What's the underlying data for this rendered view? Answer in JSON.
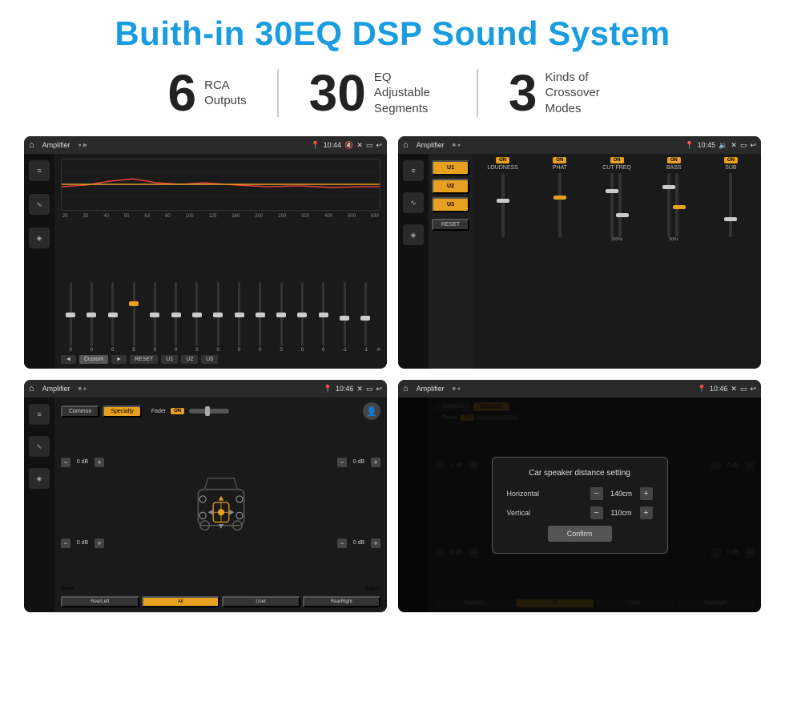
{
  "page": {
    "main_title": "Buith-in 30EQ DSP Sound System",
    "stats": [
      {
        "number": "6",
        "label": "RCA\nOutputs"
      },
      {
        "number": "30",
        "label": "EQ Adjustable\nSegments"
      },
      {
        "number": "3",
        "label": "Kinds of\nCrossover Modes"
      }
    ],
    "screens": [
      {
        "id": "screen1",
        "status_bar": {
          "app_name": "Amplifier",
          "time": "10:44"
        },
        "eq_frequencies": [
          "25",
          "32",
          "40",
          "50",
          "63",
          "80",
          "100",
          "125",
          "160",
          "200",
          "250",
          "320",
          "400",
          "500",
          "630"
        ],
        "eq_values": [
          "0",
          "0",
          "0",
          "5",
          "0",
          "0",
          "0",
          "0",
          "0",
          "0",
          "0",
          "0",
          "0",
          "-1",
          "0",
          "-1"
        ],
        "preset_label": "Custom",
        "buttons": [
          "◄",
          "Custom",
          "►",
          "RESET",
          "U1",
          "U2",
          "U3"
        ]
      },
      {
        "id": "screen2",
        "status_bar": {
          "app_name": "Amplifier",
          "time": "10:45"
        },
        "presets": [
          "U1",
          "U2",
          "U3"
        ],
        "sections": [
          "LOUDNESS",
          "PHAT",
          "CUT FREQ",
          "BASS",
          "SUB"
        ],
        "on_labels": [
          "ON",
          "ON",
          "ON",
          "ON",
          "ON"
        ],
        "reset_label": "RESET"
      },
      {
        "id": "screen3",
        "status_bar": {
          "app_name": "Amplifier",
          "time": "10:46"
        },
        "tabs": [
          "Common",
          "Specialty"
        ],
        "active_tab": "Specialty",
        "fader_label": "Fader",
        "fader_on": "ON",
        "volume_controls": [
          {
            "label": "0 dB"
          },
          {
            "label": "0 dB"
          },
          {
            "label": "0 dB"
          },
          {
            "label": "0 dB"
          }
        ],
        "bottom_buttons": [
          "Driver",
          "",
          "Copilot",
          "RearLeft",
          "All",
          "User",
          "RearRight"
        ]
      },
      {
        "id": "screen4",
        "status_bar": {
          "app_name": "Amplifier",
          "time": "10:46"
        },
        "tabs": [
          "Common",
          "Specialty"
        ],
        "dialog": {
          "title": "Car speaker distance setting",
          "rows": [
            {
              "label": "Horizontal",
              "value": "140cm"
            },
            {
              "label": "Vertical",
              "value": "110cm"
            }
          ],
          "confirm_label": "Confirm"
        },
        "bottom_buttons": [
          "Driver",
          "Copilot",
          "RearLeft",
          "All",
          "User",
          "RearRight"
        ]
      }
    ]
  }
}
